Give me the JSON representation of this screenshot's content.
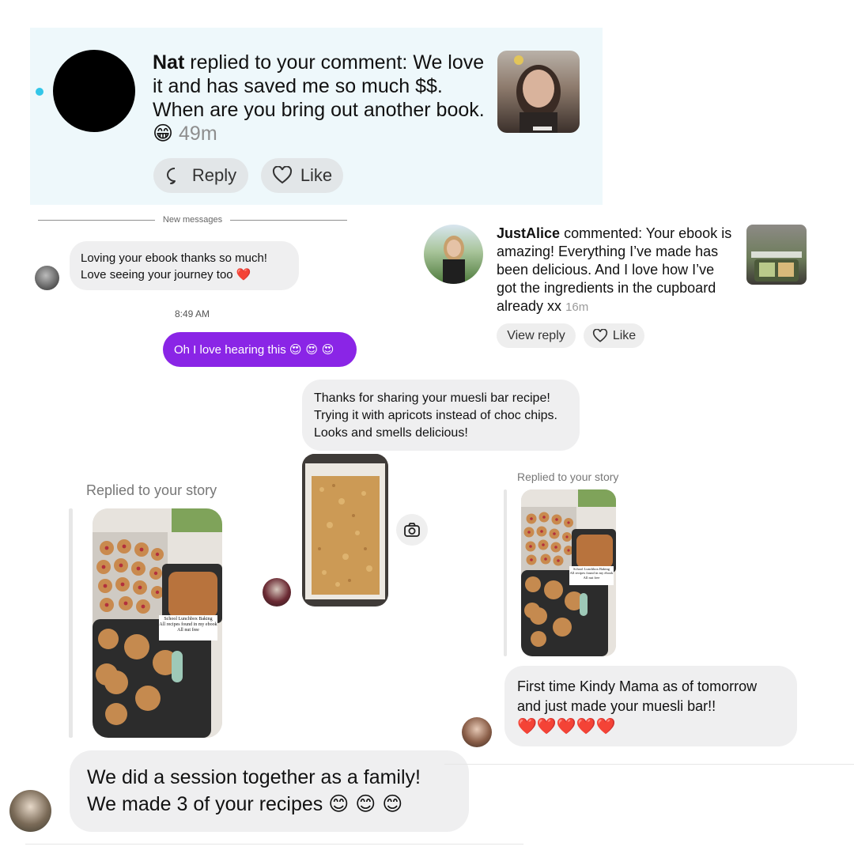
{
  "nat_notification": {
    "username": "Nat",
    "action_text": "replied to your comment: We love it and has saved me so much $$. When are you bring out another book.",
    "emoji": "😁",
    "time": "49m",
    "reply_label": "Reply",
    "like_label": "Like"
  },
  "dm_thread": {
    "divider_label": "New messages",
    "incoming_message": "Loving your ebook thanks so much! Love seeing your journey too",
    "incoming_emoji": "❤️",
    "timestamp": "8:49 AM",
    "outgoing_message": "Oh I love hearing this",
    "outgoing_emoji": "😍 😍 😍"
  },
  "alice_notification": {
    "username": "JustAlice",
    "action_text": "commented: Your ebook is amazing! Everything I’ve made has been delicious. And I love how I’ve got the ingredients in the cupboard already xx",
    "time": "16m",
    "view_reply_label": "View reply",
    "like_label": "Like"
  },
  "muesli_message": {
    "text": "Thanks for sharing your muesli bar recipe! Trying it with apricots instead of choc chips. Looks and smells delicious!"
  },
  "story_reply_left": {
    "label": "Replied to your story",
    "caption_title": "School Lunchbox Baking",
    "caption_line2": "All recipes found in my ebook",
    "caption_line3": "All nut free",
    "message": "We did a session together as a family! We made 3 of your recipes",
    "message_emoji": "😊 😊 😊"
  },
  "story_reply_right": {
    "label": "Replied to your story",
    "caption_title": "School Lunchbox Baking",
    "caption_line2": "All recipes found in my ebook",
    "caption_line3": "All nut free",
    "message": "First time Kindy Mama as of tomorrow and just made your muesli bar!!",
    "message_emoji": "❤️❤️❤️❤️❤️"
  },
  "colors": {
    "nat_panel_bg": "#eef8fb",
    "unread_dot": "#32c6e8",
    "outgoing_bubble": "#8a25e6",
    "incoming_bubble": "#efeff0",
    "heart_red": "#e0182d"
  }
}
